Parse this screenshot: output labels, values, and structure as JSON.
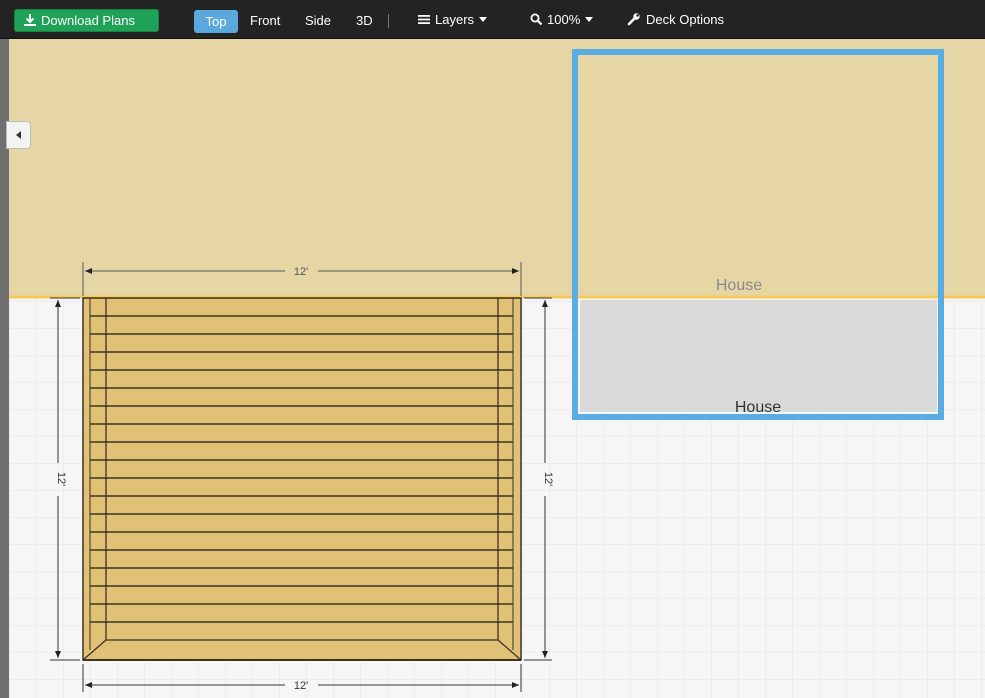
{
  "toolbar": {
    "download_label": "Download Plans",
    "views": [
      "Top",
      "Front",
      "Side",
      "3D"
    ],
    "active_view": "Top",
    "layers_label": "Layers",
    "zoom_label": "100%",
    "deck_options_label": "Deck Options"
  },
  "canvas": {
    "house_outline_label": "House",
    "house_wall_label": "House",
    "deck_width_top": "12'",
    "deck_width_bottom": "12'",
    "deck_depth_left": "12'",
    "deck_depth_right": "12'",
    "board_count": 19
  },
  "colors": {
    "toolbar_bg": "#232323",
    "download_green": "#1fa257",
    "active_view_blue": "#5aa8de",
    "house_fill": "#e6d6a6",
    "house_line": "#f4c95a",
    "house_outline_blue": "#5aade3",
    "house_wall_gray": "#d9d9d9",
    "deck_fill": "#e0c176",
    "deck_board_line": "#3b3220",
    "grid_bg": "#f6f6f6",
    "grid_line": "#e4e4e4"
  },
  "icons": {
    "download": "download-icon",
    "layers": "layers-icon",
    "zoom": "magnifier-icon",
    "deck_options": "wrench-icon",
    "collapse": "collapse-left-icon"
  }
}
